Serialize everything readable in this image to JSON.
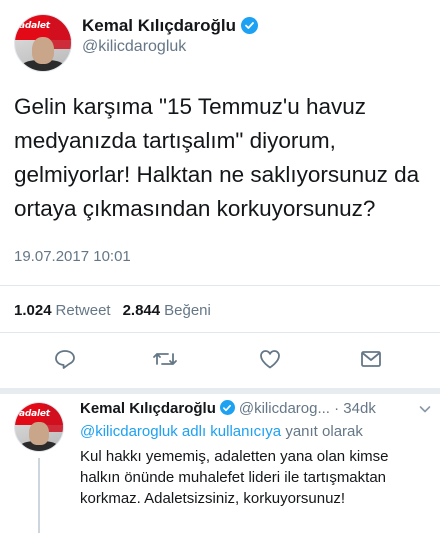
{
  "tweet": {
    "display_name": "Kemal Kılıçdaroğlu",
    "handle": "@kilicdarogluk",
    "avatar_logo_text": "adalet",
    "text": "Gelin karşıma \"15 Temmuz'u havuz medyanızda tartışalım\" diyorum, gelmiyorlar! Halktan ne saklıyorsunuz da ortaya çıkmasından korkuyorsunuz?",
    "timestamp": "19.07.2017 10:01",
    "retweet_count": "1.024",
    "retweet_label": "Retweet",
    "like_count": "2.844",
    "like_label": "Beğeni"
  },
  "actions": [
    {
      "name": "reply-icon"
    },
    {
      "name": "retweet-icon"
    },
    {
      "name": "like-icon"
    },
    {
      "name": "direct-message-icon"
    }
  ],
  "reply": {
    "display_name": "Kemal Kılıçdaroğlu",
    "handle_time": "@kilicdarog... · 34dk",
    "avatar_logo_text": "adalet",
    "mention": "@kilicdarogluk adlı kullanıcıya",
    "context_rest": "yanıt olarak",
    "text": "Kul hakkı yememiş, adaletten yana olan kimse halkın önünde muhalefet lideri ile tartışmaktan korkmaz. Adaletsizsiniz, korkuyorsunuz!"
  },
  "colors": {
    "accent": "#1da1f2",
    "muted": "#657786",
    "text": "#14171a",
    "divider": "#e1e8ed"
  }
}
